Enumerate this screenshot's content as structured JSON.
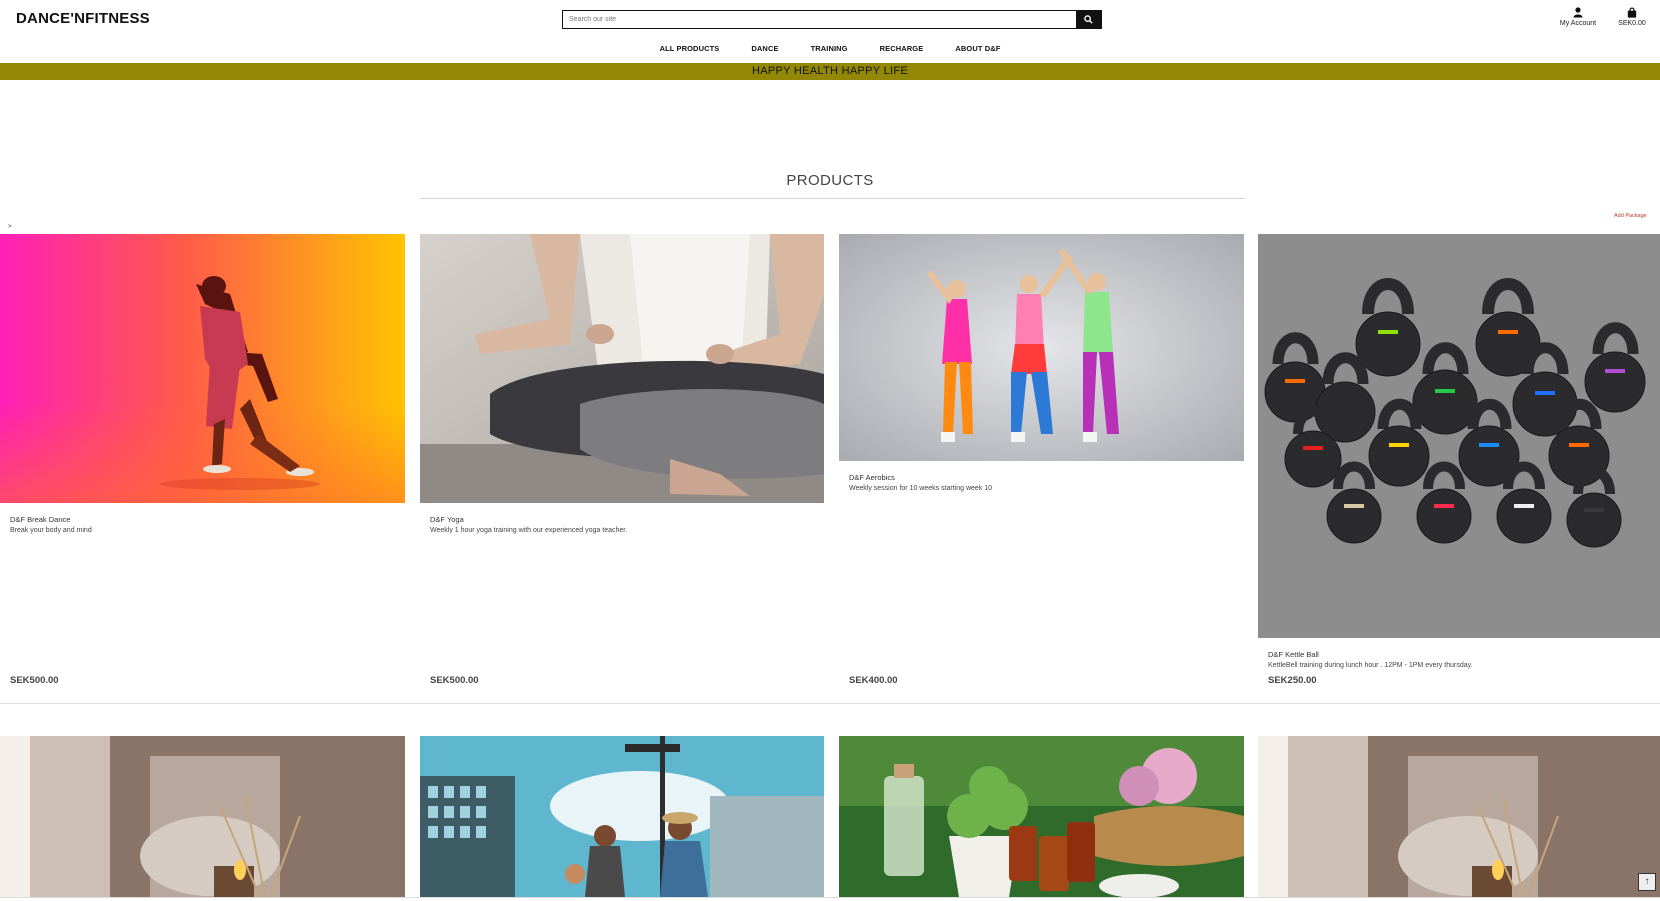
{
  "header": {
    "logo": "DANCE'NFITNESS",
    "search_placeholder": "Search our site",
    "account_label": "My Account",
    "cart_total": "SEK0.00"
  },
  "nav": {
    "items": [
      {
        "label": "ALL PRODUCTS"
      },
      {
        "label": "DANCE"
      },
      {
        "label": "TRAINING"
      },
      {
        "label": "RECHARGE"
      },
      {
        "label": "ABOUT D&F"
      }
    ]
  },
  "banner": {
    "text": "HAPPY HEALTH HAPPY LIFE"
  },
  "products": {
    "title": "PRODUCTS",
    "arrow": ">",
    "add_package": "Add Package",
    "items": [
      {
        "name": "D&F Break Dance",
        "desc": "Break your body and mind",
        "price": "SEK500.00"
      },
      {
        "name": "D&F Yoga",
        "desc": "Weekly 1 hour yoga training with our experienced yoga teacher.",
        "price": "SEK500.00"
      },
      {
        "name": "D&F Aerobics",
        "desc": "Weekly session for 10 weeks starting week 10",
        "price": "SEK400.00"
      },
      {
        "name": "D&F Kettle Ball",
        "desc": "KettleBell training during lunch hour . 12PM - 1PM every thursday.",
        "price": "SEK250.00"
      }
    ]
  },
  "colors": {
    "banner": "#928806",
    "add_package": "#c0392b"
  }
}
